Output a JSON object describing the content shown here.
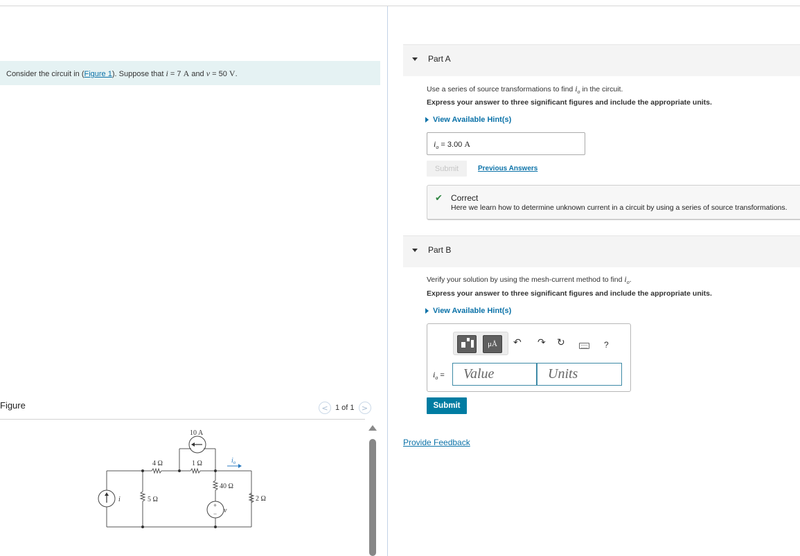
{
  "problem": {
    "prefix": "Consider the circuit in (",
    "figure_link": "Figure 1",
    "middle": "). Suppose that ",
    "i_sym": "i",
    "i_eq": " = 7 ",
    "i_unit": "A",
    "and": " and ",
    "v_sym": "v",
    "v_eq": " = 50 ",
    "v_unit": "V",
    "end": "."
  },
  "figure": {
    "label": "Figure",
    "pager_text": "1 of 1",
    "prev_glyph": "<",
    "next_glyph": ">",
    "circuit_labels": {
      "source_current": "i",
      "current_10": "10 A",
      "r_4": "4 Ω",
      "r_1": "1 Ω",
      "io": "i",
      "io_sub": "o",
      "r_40": "40 Ω",
      "r_5": "5 Ω",
      "r_2": "2 Ω",
      "v_plus": "+",
      "v_minus": "−",
      "v_label": "v"
    }
  },
  "partA": {
    "title": "Part A",
    "instruction_prefix": "Use a series of source transformations to find ",
    "instruction_sym": "i",
    "instruction_sub": "o",
    "instruction_suffix": " in the circuit.",
    "bold_instruction": "Express your answer to three significant figures and include the appropriate units.",
    "hint_label": "View Available Hint(s)",
    "answer_sym": "i",
    "answer_sub": "o",
    "answer_eq": " = ",
    "answer_value": "3.00 ",
    "answer_unit": "A",
    "submit_label": "Submit",
    "previous_answers": "Previous Answers",
    "feedback_title": "Correct",
    "feedback_text": "Here we learn how to determine unknown current in a circuit by using a series of source transformations."
  },
  "partB": {
    "title": "Part B",
    "instruction_prefix": "Verify your solution by using the mesh-current method to find ",
    "instruction_sym": "i",
    "instruction_sub": "o",
    "instruction_suffix": ".",
    "bold_instruction": "Express your answer to three significant figures and include the appropriate units.",
    "hint_label": "View Available Hint(s)",
    "toolbar": {
      "units_glyph": "μÅ",
      "undo_glyph": "↶",
      "redo_glyph": "↷",
      "reset_glyph": "↻",
      "help_glyph": "?"
    },
    "input_sym": "i",
    "input_sub": "o",
    "input_eq": " =",
    "value_placeholder": "Value",
    "units_placeholder": "Units",
    "submit_label": "Submit"
  },
  "provide_feedback": "Provide Feedback",
  "colors": {
    "link": "#0b72a8",
    "problem_bg": "#e5f2f3",
    "submit": "#007ca2",
    "correct": "#2e8540"
  }
}
